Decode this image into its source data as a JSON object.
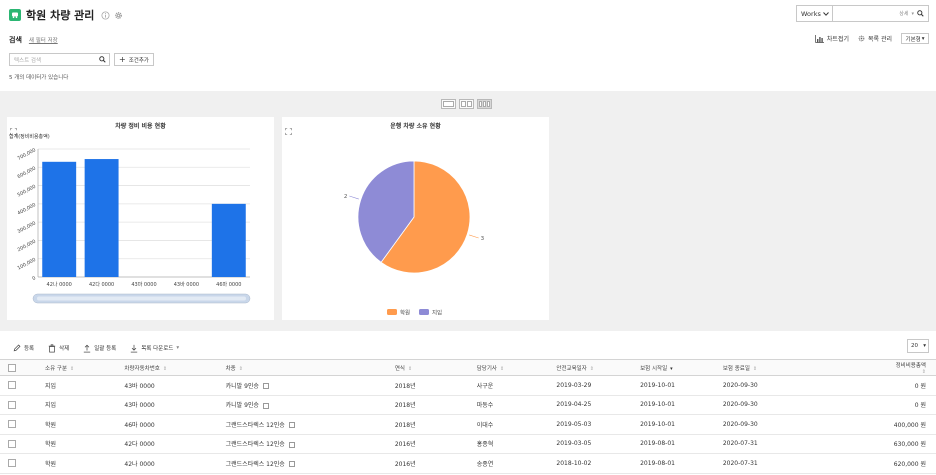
{
  "header": {
    "title": "학원 차량 관리",
    "works_select": "Works",
    "search_scope": "상세"
  },
  "search": {
    "label": "검색",
    "save_filter": "새 필터 저장",
    "placeholder": "텍스트 검색",
    "add_condition": "조건추가",
    "no_data_message": "5 개의 데이터가 있습니다"
  },
  "toolbar_right": {
    "chart_collapse": "차트접기",
    "list_manage": "목록 관리",
    "view_select": "기본형"
  },
  "colors": {
    "bar": "#1e73e8",
    "pie_academy": "#ff9b4d",
    "pie_branch": "#8e8bd6",
    "app_icon": "#2bb673"
  },
  "bar_chart": {
    "title": "차량 정비 비용 현황",
    "y_title": "합계(정비비용총액)"
  },
  "pie_chart": {
    "title": "운행 차량 소유 현황",
    "label_branch": "2",
    "label_academy": "3"
  },
  "chart_data": [
    {
      "type": "bar",
      "title": "차량 정비 비용 현황",
      "ylabel": "합계(정비비용총액)",
      "categories": [
        "42나 0000",
        "42다 0000",
        "43마 0000",
        "43바 0000",
        "46마 0000"
      ],
      "values": [
        630000,
        645000,
        0,
        0,
        400000
      ],
      "ylim": [
        0,
        700000
      ],
      "yticks": [
        "0",
        "100,000",
        "200,000",
        "300,000",
        "400,000",
        "500,000",
        "600,000",
        "700,000"
      ]
    },
    {
      "type": "pie",
      "title": "운행 차량 소유 현황",
      "labels": [
        "학원",
        "지입"
      ],
      "values": [
        3,
        2
      ],
      "legend": "bottom"
    }
  ],
  "table_toolbar": {
    "register": "등록",
    "delete": "삭제",
    "bulk_register": "일괄 등록",
    "list_download": "목록 다운로드",
    "per_page": "20"
  },
  "table": {
    "columns": [
      "소유 구분",
      "차량자동차번호",
      "차종",
      "연식",
      "담당기사",
      "안전교육일자",
      "보험 시작일",
      "보험 종료일",
      "정비비용총액"
    ],
    "rows": [
      [
        "지입",
        "43바 0000",
        "카니발 9인승",
        "2018년",
        "사구운",
        "2019-03-29",
        "2019-10-01",
        "2020-09-30",
        "0 원"
      ],
      [
        "지입",
        "43마 0000",
        "카니발 9인승",
        "2018년",
        "마동수",
        "2019-04-25",
        "2019-10-01",
        "2020-09-30",
        "0 원"
      ],
      [
        "학원",
        "46마 0000",
        "그랜드스타렉스 12인승",
        "2018년",
        "이대수",
        "2019-05-03",
        "2019-10-01",
        "2020-09-30",
        "400,000 원"
      ],
      [
        "학원",
        "42다 0000",
        "그랜드스타렉스 12인승",
        "2016년",
        "홍종혁",
        "2019-03-05",
        "2019-08-01",
        "2020-07-31",
        "630,000 원"
      ],
      [
        "학원",
        "42나 0000",
        "그랜드스타렉스 12인승",
        "2016년",
        "송종연",
        "2018-10-02",
        "2019-08-01",
        "2020-07-31",
        "620,000 원"
      ]
    ]
  }
}
